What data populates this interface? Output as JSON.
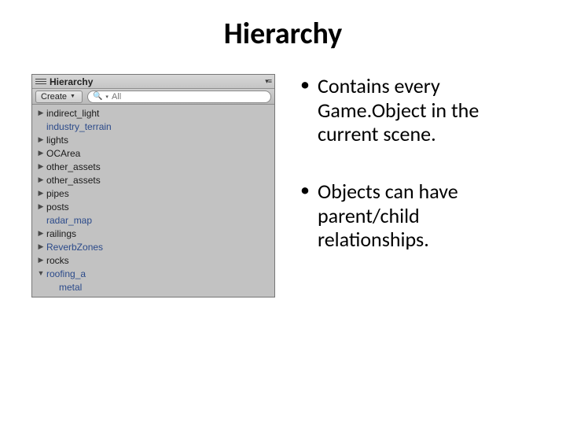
{
  "title": "Hierarchy",
  "panel": {
    "tab_label": "Hierarchy",
    "create_label": "Create",
    "search_placeholder": "All"
  },
  "hierarchy_items": [
    {
      "label": "indirect_light",
      "arrow": "right",
      "kind": "normal",
      "indent": 0
    },
    {
      "label": "industry_terrain",
      "arrow": "none",
      "kind": "prefab",
      "indent": 0
    },
    {
      "label": "lights",
      "arrow": "right",
      "kind": "normal",
      "indent": 0
    },
    {
      "label": "OCArea",
      "arrow": "right",
      "kind": "normal",
      "indent": 0
    },
    {
      "label": "other_assets",
      "arrow": "right",
      "kind": "normal",
      "indent": 0
    },
    {
      "label": "other_assets",
      "arrow": "right",
      "kind": "normal",
      "indent": 0
    },
    {
      "label": "pipes",
      "arrow": "right",
      "kind": "normal",
      "indent": 0
    },
    {
      "label": "posts",
      "arrow": "right",
      "kind": "normal",
      "indent": 0
    },
    {
      "label": "radar_map",
      "arrow": "none",
      "kind": "prefab",
      "indent": 0
    },
    {
      "label": "railings",
      "arrow": "right",
      "kind": "normal",
      "indent": 0
    },
    {
      "label": "ReverbZones",
      "arrow": "right",
      "kind": "prefab",
      "indent": 0
    },
    {
      "label": "rocks",
      "arrow": "right",
      "kind": "normal",
      "indent": 0
    },
    {
      "label": "roofing_a",
      "arrow": "down",
      "kind": "prefab",
      "indent": 0
    },
    {
      "label": "metal",
      "arrow": "none",
      "kind": "prefab",
      "indent": 1
    }
  ],
  "bullets": [
    "Contains every Game.Object in the current scene.",
    "Objects can have parent/child relationships."
  ]
}
